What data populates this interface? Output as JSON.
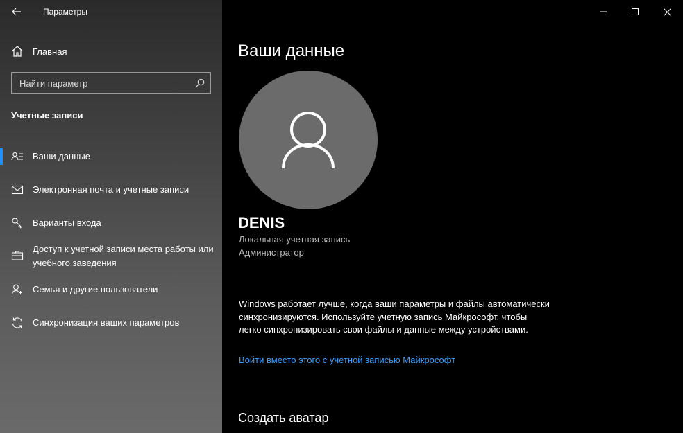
{
  "window": {
    "app_title": "Параметры"
  },
  "sidebar": {
    "home_label": "Главная",
    "search_placeholder": "Найти параметр",
    "section_title": "Учетные записи",
    "items": [
      {
        "label": "Ваши данные",
        "icon": "person-card-icon",
        "selected": true
      },
      {
        "label": "Электронная почта и учетные записи",
        "icon": "mail-icon",
        "selected": false
      },
      {
        "label": "Варианты входа",
        "icon": "key-icon",
        "selected": false
      },
      {
        "label": "Доступ к учетной записи места работы или учебного заведения",
        "icon": "briefcase-icon",
        "selected": false
      },
      {
        "label": "Семья и другие пользователи",
        "icon": "person-add-icon",
        "selected": false
      },
      {
        "label": "Синхронизация ваших параметров",
        "icon": "sync-icon",
        "selected": false
      }
    ]
  },
  "main": {
    "page_title": "Ваши данные",
    "user_name": "DENIS",
    "account_type": "Локальная учетная запись",
    "account_role": "Администратор",
    "info_text": "Windows работает лучше, когда ваши параметры и файлы автоматически синхронизируются. Используйте учетную запись Майкрософт, чтобы легко синхронизировать свои файлы и данные между устройствами.",
    "ms_link": "Войти вместо этого с учетной записью Майкрософт",
    "create_avatar_heading": "Создать аватар"
  },
  "colors": {
    "accent": "#1e90ff",
    "link": "#3aa0ff",
    "avatar_bg": "#6b6b6b",
    "main_bg": "#000000"
  }
}
